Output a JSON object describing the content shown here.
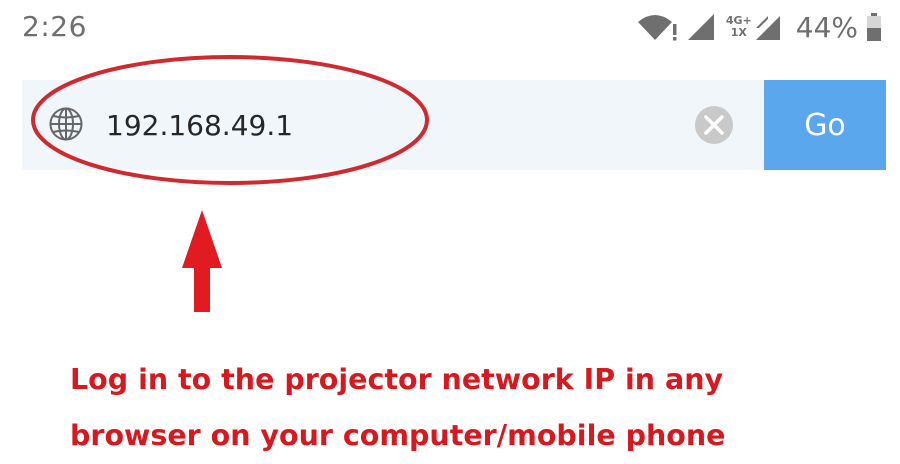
{
  "status_bar": {
    "time": "2:26",
    "network_type_top": "4G+",
    "network_type_bottom": "1X",
    "battery_percent": "44%"
  },
  "address_bar": {
    "url": "192.168.49.1",
    "go_label": "Go"
  },
  "annotation": {
    "line1": "Log in to the projector network IP in any",
    "line2": "browser on your computer/mobile phone",
    "color": "#d7191f"
  },
  "icons": {
    "wifi": "wifi-alert-icon",
    "signal": "cell-signal-icon",
    "battery": "battery-icon",
    "globe": "globe-icon",
    "clear": "clear-icon"
  },
  "colors": {
    "go_button": "#5aa7ed",
    "address_bar_bg": "#f0f6fa",
    "status_text": "#6f6f6f"
  }
}
